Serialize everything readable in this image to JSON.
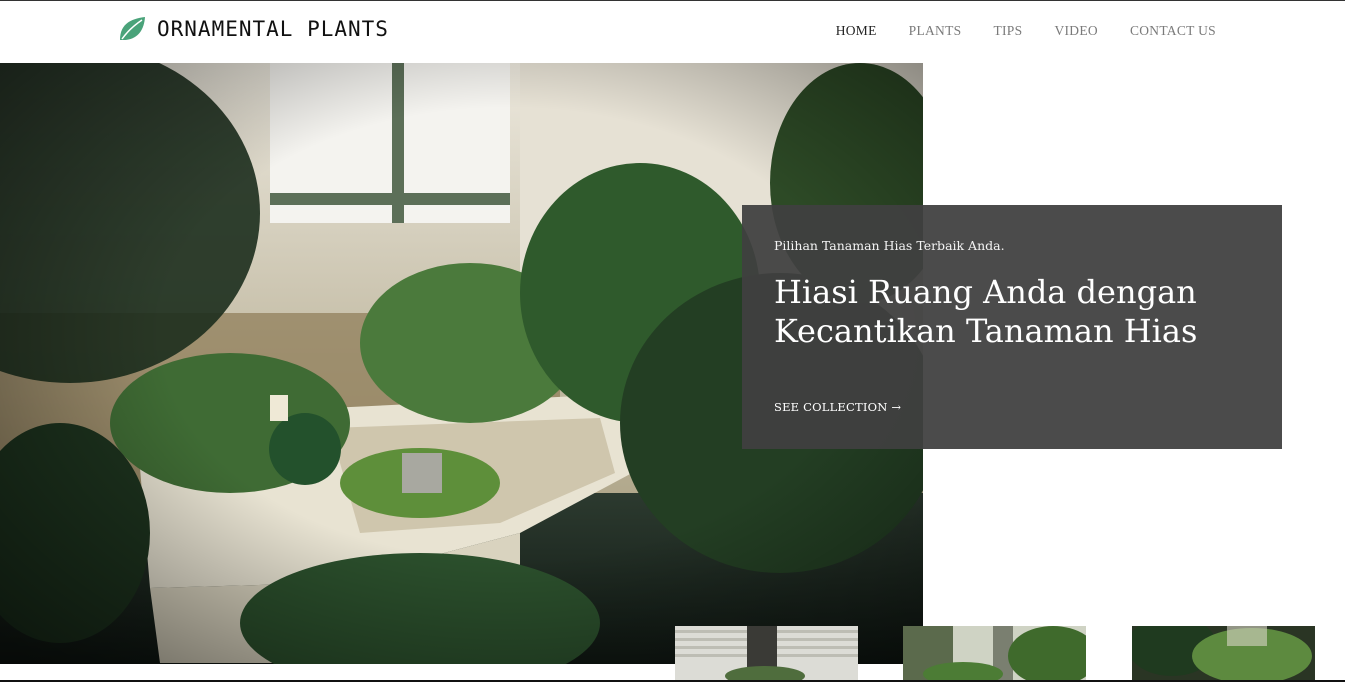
{
  "brand": {
    "name": "ORNAMENTAL PLANTS",
    "logo_icon": "leaf-icon",
    "logo_color": "#4aa37a"
  },
  "nav": {
    "items": [
      {
        "label": "HOME",
        "active": true
      },
      {
        "label": "PLANTS",
        "active": false
      },
      {
        "label": "TIPS",
        "active": false
      },
      {
        "label": "VIDEO",
        "active": false
      },
      {
        "label": "CONTACT US",
        "active": false
      }
    ]
  },
  "hero": {
    "tagline": "Pilihan Tanaman Hias Terbaik Anda.",
    "headline_line1": "Hiasi Ruang Anda dengan",
    "headline_line2": "Kecantikan Tanaman Hias",
    "cta_label": "SEE COLLECTION",
    "cta_icon": "arrow-right-icon"
  },
  "colors": {
    "overlay": "#404040",
    "nav_active": "#222222",
    "nav_inactive": "#7a7a7a"
  }
}
